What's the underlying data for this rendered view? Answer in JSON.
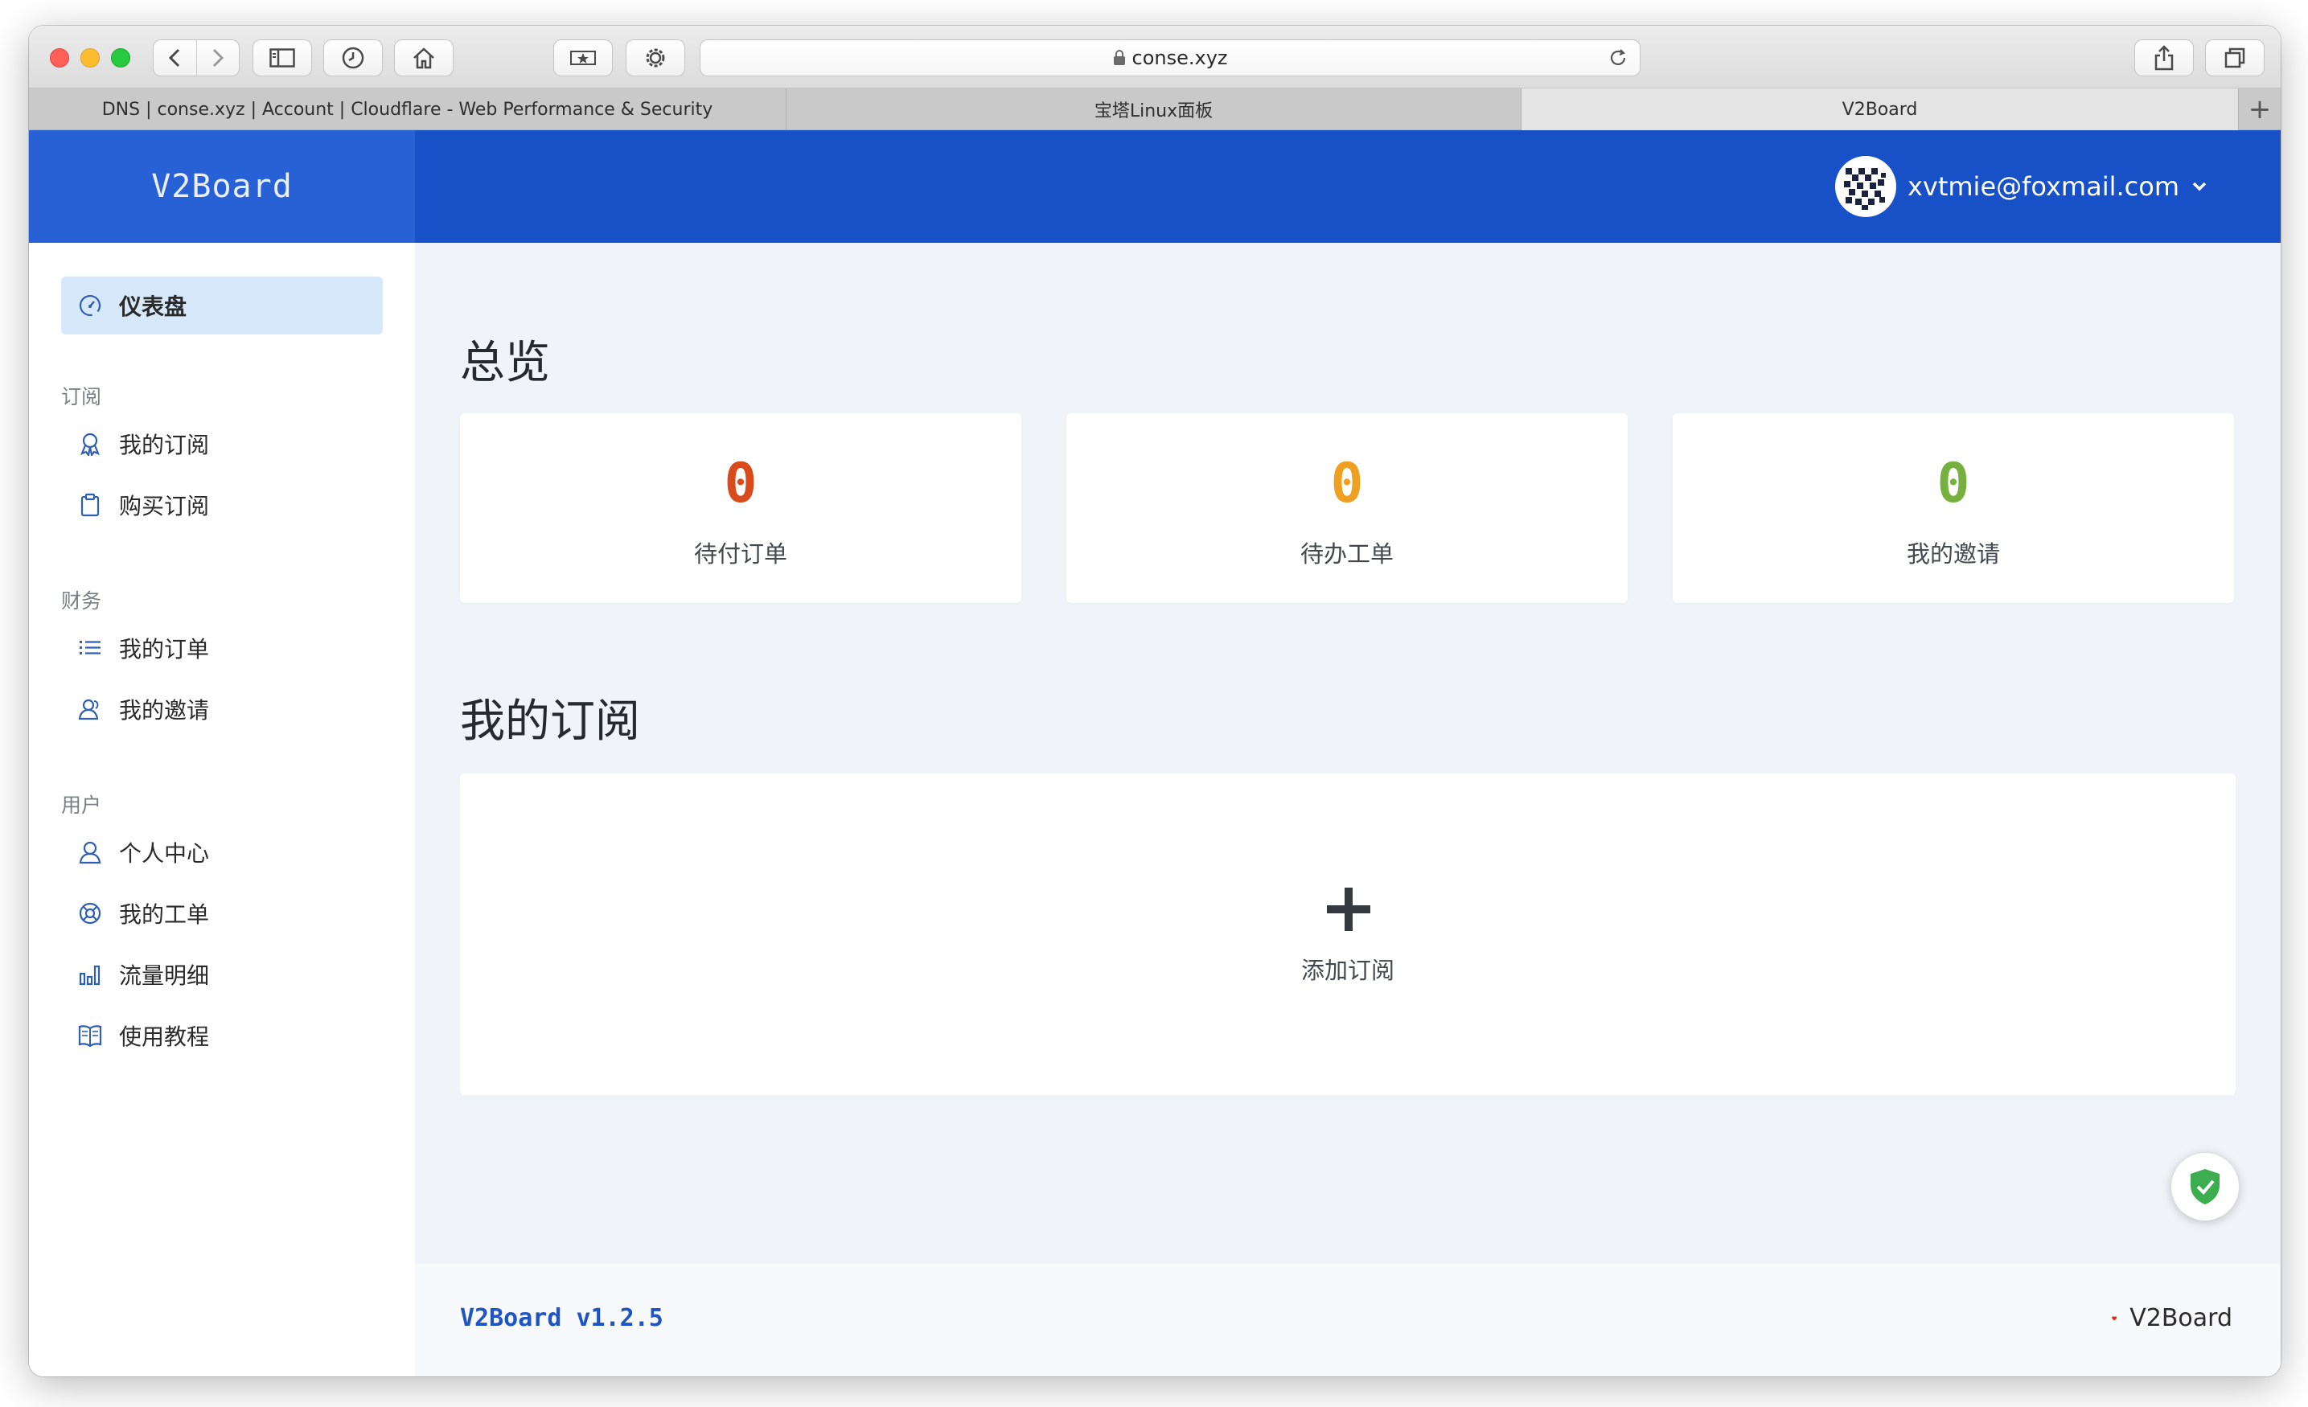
{
  "browser": {
    "url": "conse.xyz",
    "tabs": [
      {
        "label": "DNS | conse.xyz | Account | Cloudflare - Web Performance & Security"
      },
      {
        "label": "宝塔Linux面板"
      },
      {
        "label": "V2Board"
      }
    ],
    "new_tab": "+"
  },
  "app": {
    "brand": "V2Board",
    "user_email": "xvtmie@foxmail.com",
    "colors": {
      "header": "#1850c8",
      "accent": "#1e55c2",
      "active_nav": "#d7e8fb"
    }
  },
  "sidebar": {
    "dashboard": {
      "label": "仪表盘",
      "icon": "dashboard-gauge-icon"
    },
    "sections": [
      {
        "heading": "订阅",
        "items": [
          {
            "label": "我的订阅",
            "icon": "award-icon"
          },
          {
            "label": "购买订阅",
            "icon": "clipboard-icon"
          }
        ]
      },
      {
        "heading": "财务",
        "items": [
          {
            "label": "我的订单",
            "icon": "list-icon"
          },
          {
            "label": "我的邀请",
            "icon": "users-icon"
          }
        ]
      },
      {
        "heading": "用户",
        "items": [
          {
            "label": "个人中心",
            "icon": "user-icon"
          },
          {
            "label": "我的工单",
            "icon": "life-ring-icon"
          },
          {
            "label": "流量明细",
            "icon": "bar-chart-icon"
          },
          {
            "label": "使用教程",
            "icon": "book-icon"
          }
        ]
      }
    ]
  },
  "overview": {
    "title": "总览",
    "stats": [
      {
        "value": "0",
        "label": "待付订单",
        "color": "#d94a1c"
      },
      {
        "value": "0",
        "label": "待办工单",
        "color": "#f0a020"
      },
      {
        "value": "0",
        "label": "我的邀请",
        "color": "#76b140"
      }
    ]
  },
  "subscription": {
    "title": "我的订阅",
    "add_label": "添加订阅"
  },
  "footer": {
    "version": "V2Board v1.2.5",
    "right_text": "V2Board"
  }
}
